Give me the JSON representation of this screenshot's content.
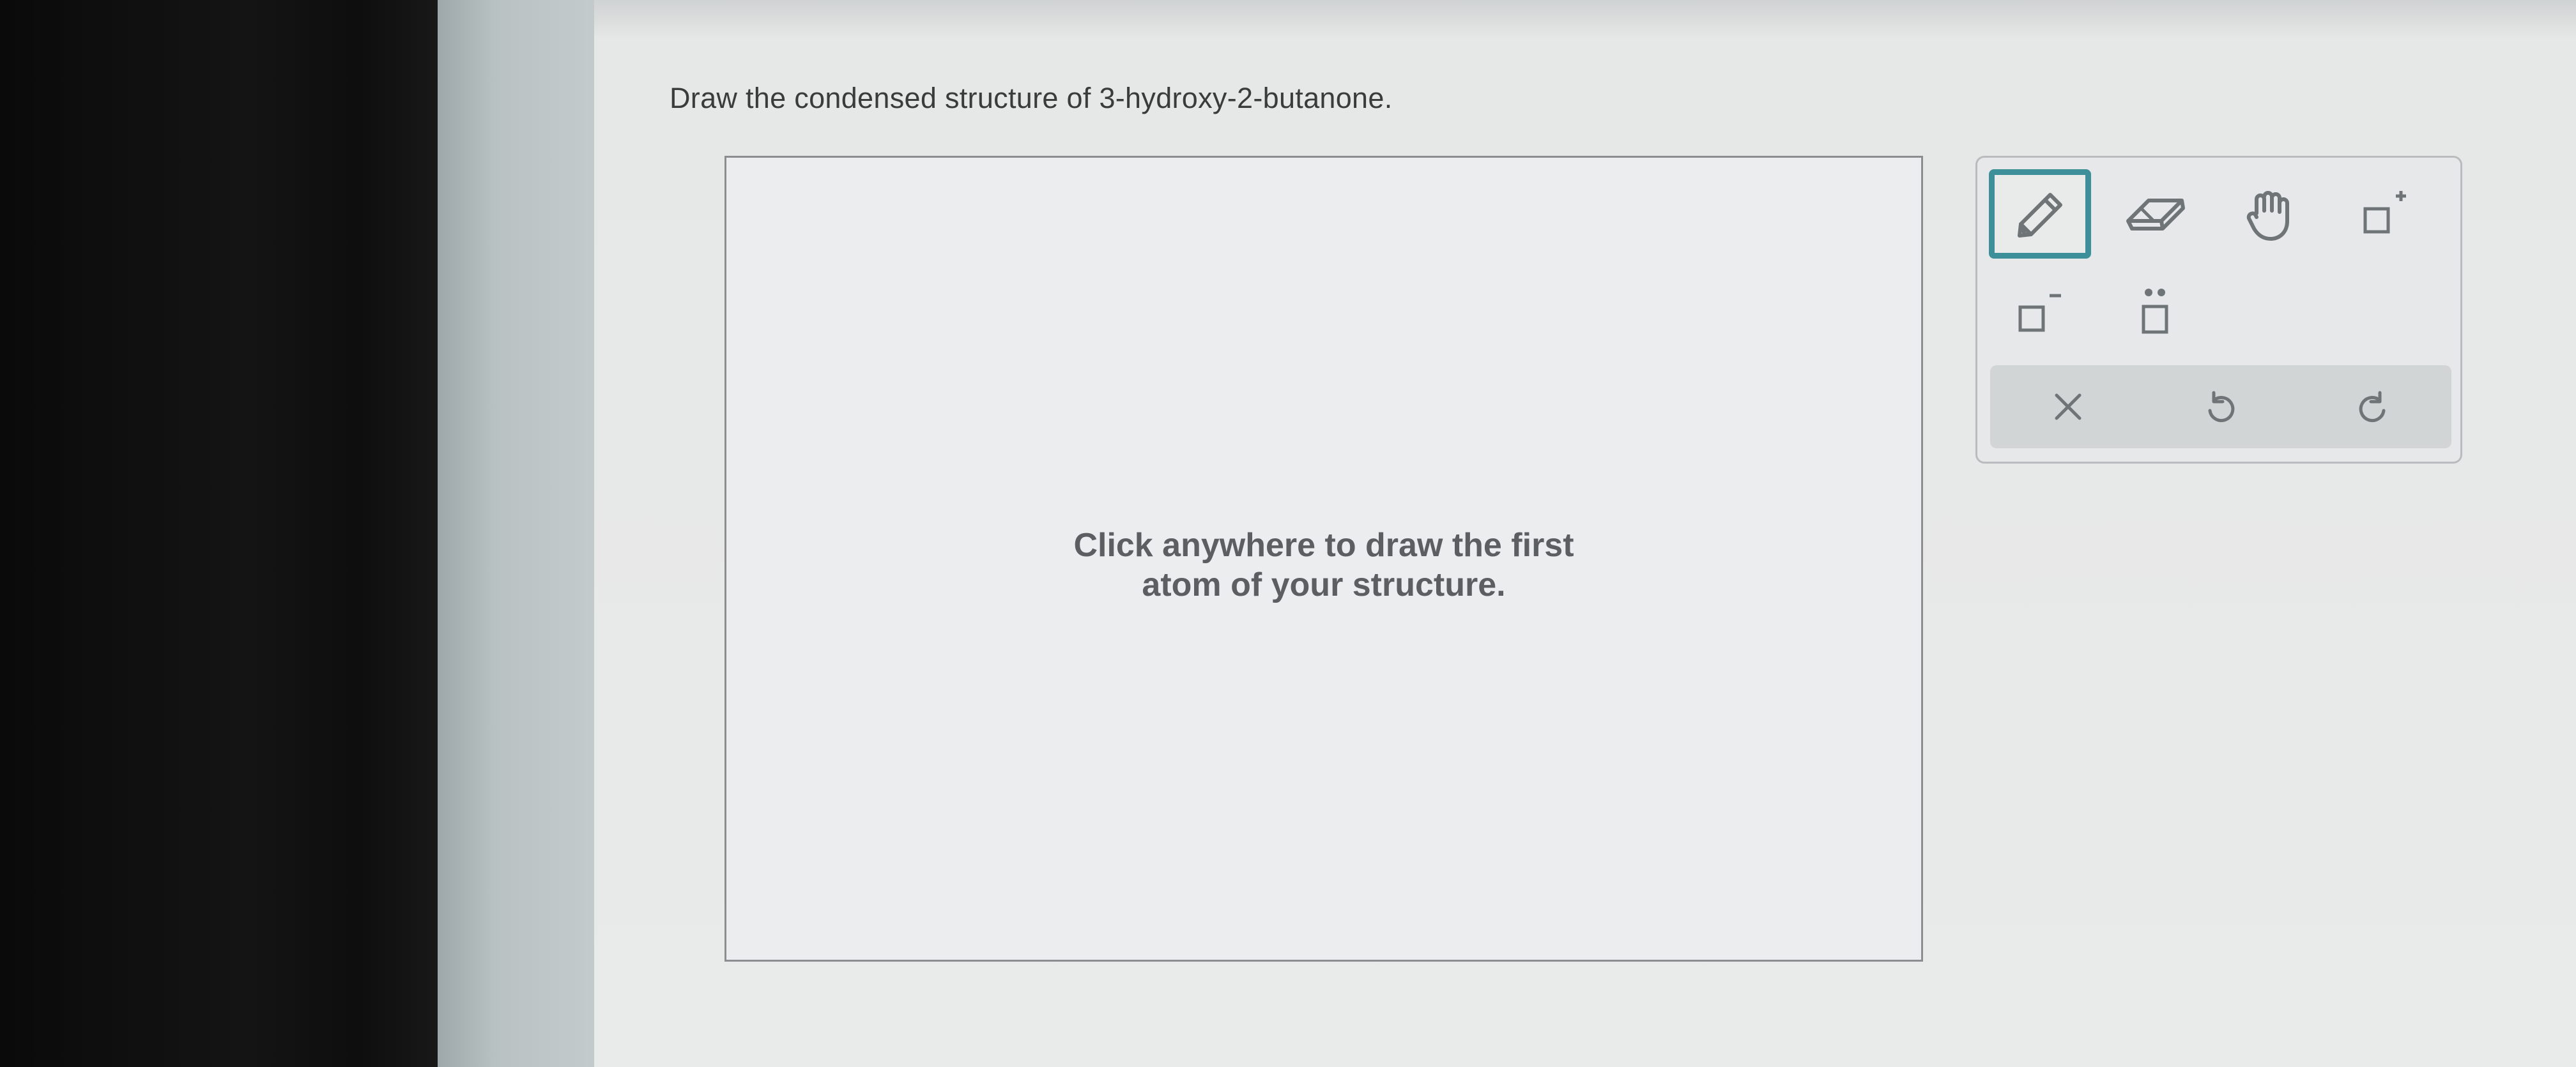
{
  "question": {
    "prompt": "Draw the condensed structure of 3-hydroxy-2-butanone."
  },
  "canvas": {
    "hint_line1": "Click anywhere to draw the first",
    "hint_line2": "atom of your structure."
  },
  "toolbar": {
    "tools": [
      {
        "icon": "pencil-icon",
        "active": true
      },
      {
        "icon": "eraser-icon",
        "active": false
      },
      {
        "icon": "hand-icon",
        "active": false
      },
      {
        "icon": "positive-charge-icon",
        "active": false
      },
      {
        "icon": "negative-charge-icon",
        "active": false
      },
      {
        "icon": "lone-pair-icon",
        "active": false
      }
    ],
    "actions": [
      {
        "icon": "clear-icon"
      },
      {
        "icon": "undo-icon"
      },
      {
        "icon": "redo-icon"
      }
    ]
  },
  "colors": {
    "accent": "#3d8f9a",
    "icon": "#6f7477",
    "page_bg": "#e9eaea"
  }
}
